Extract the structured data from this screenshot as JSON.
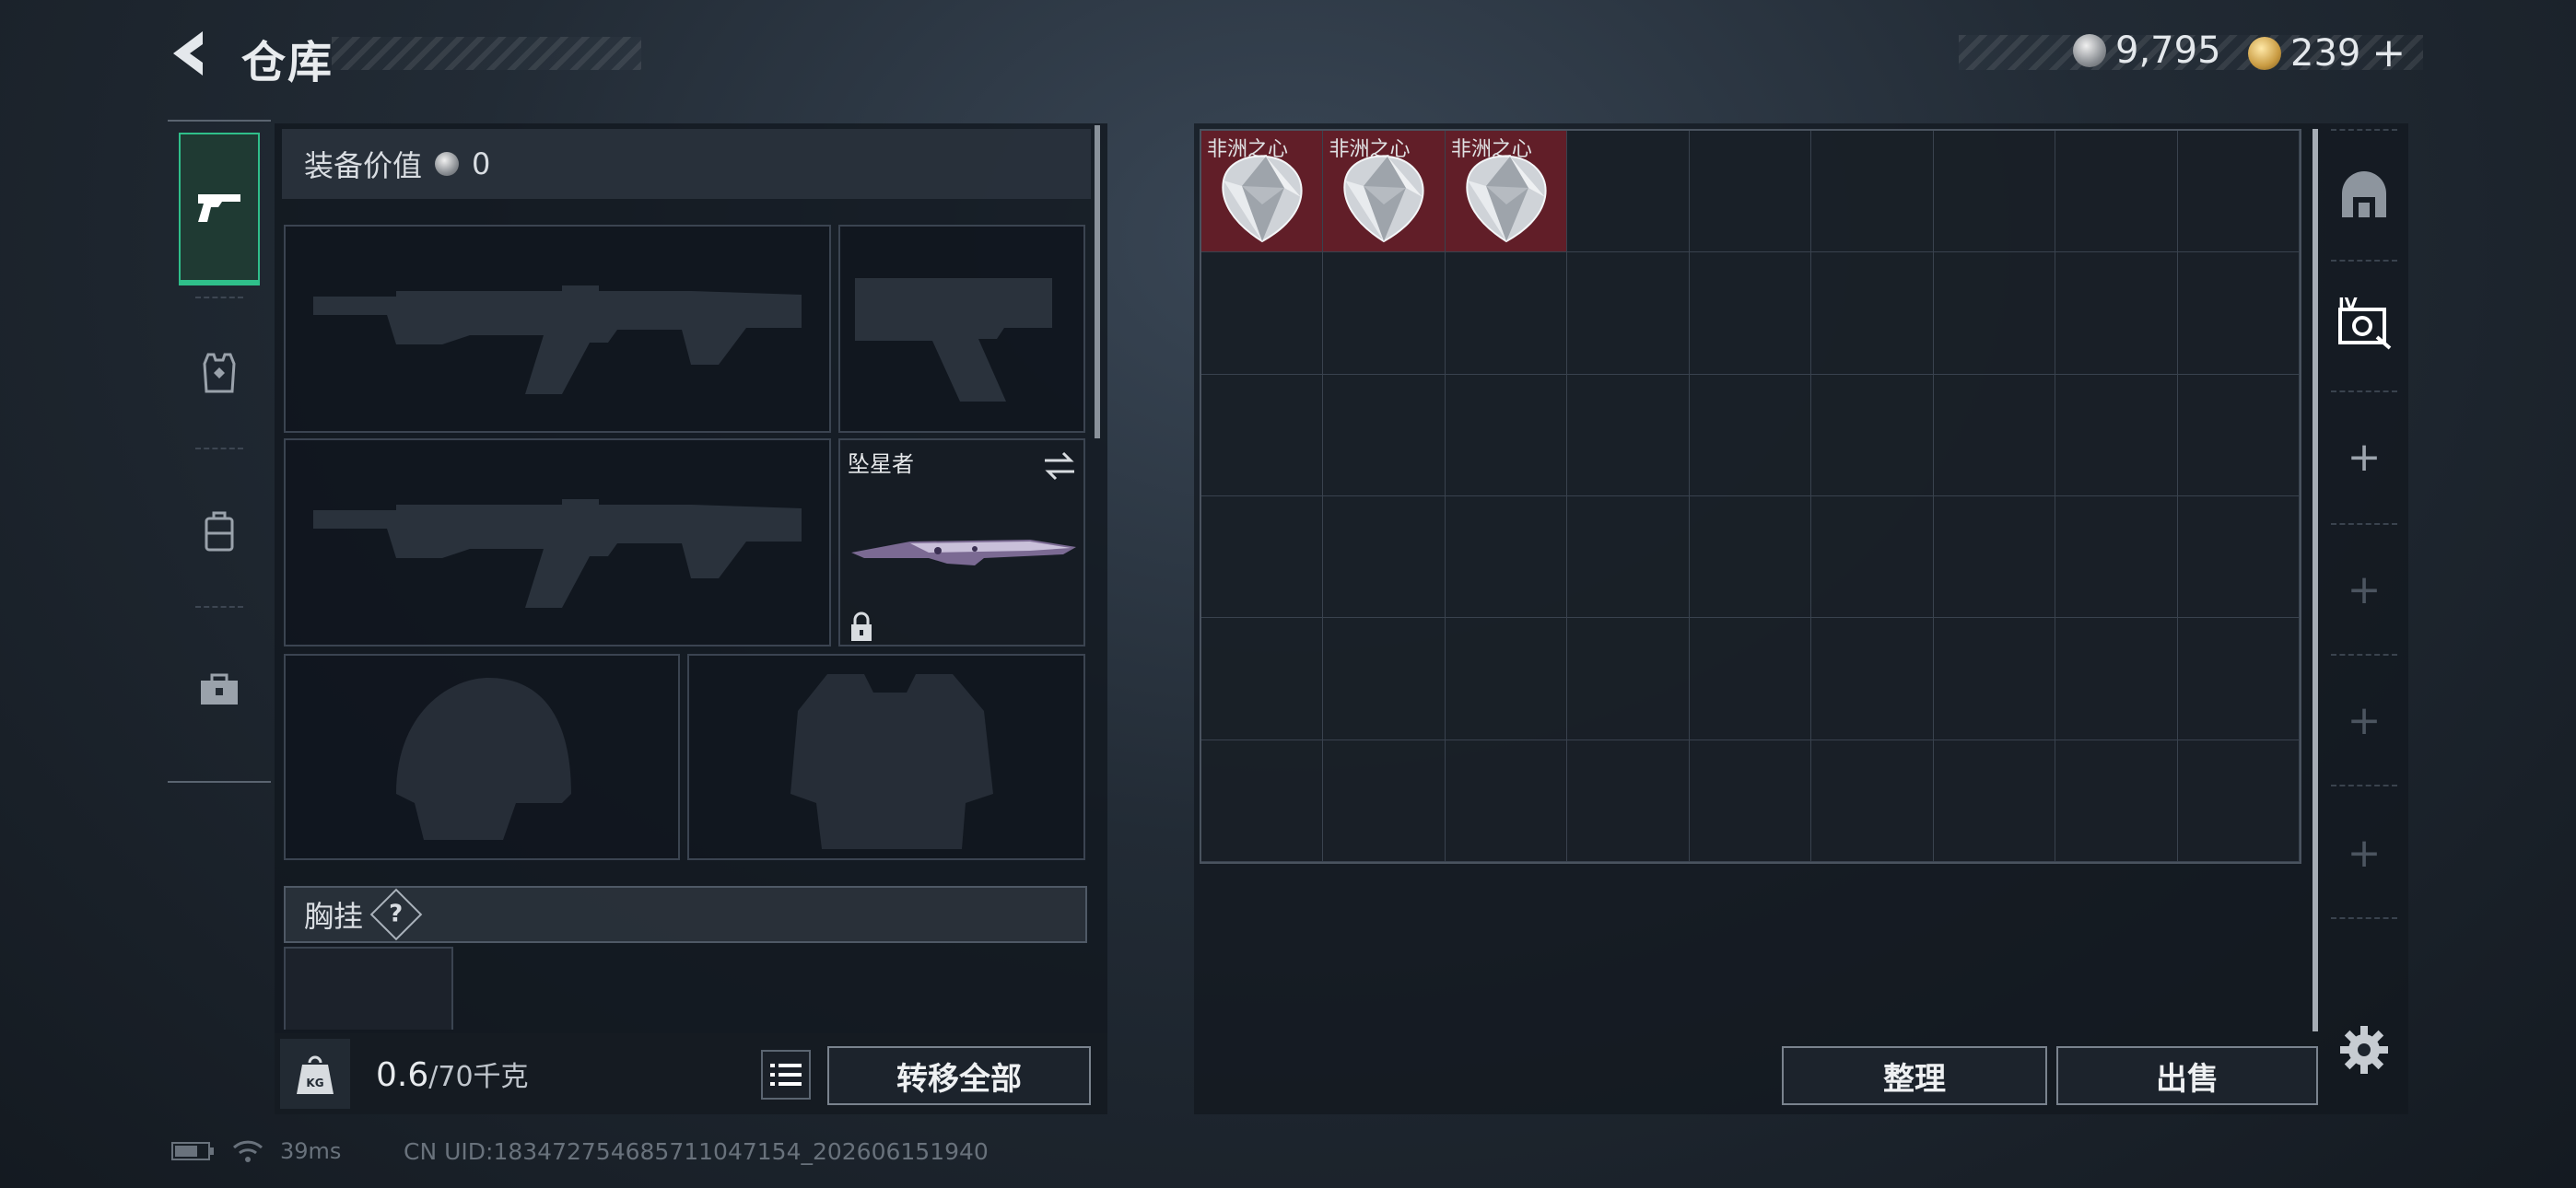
{
  "header": {
    "title": "仓库",
    "silver_amount": "9,795",
    "gold_amount": "239",
    "add_symbol": "+"
  },
  "nav": {
    "items": [
      {
        "name": "weapons",
        "icon": "pistol-icon",
        "active": true
      },
      {
        "name": "armor",
        "icon": "vest-icon",
        "active": false
      },
      {
        "name": "backpack",
        "icon": "backpack-icon",
        "active": false
      },
      {
        "name": "toolbox",
        "icon": "toolbox-icon",
        "active": false
      }
    ]
  },
  "equipment": {
    "value_label": "装备价值",
    "value": "0",
    "melee_name": "坠星者",
    "chest_rig_label": "胸挂",
    "chest_rig_help": "?"
  },
  "weight": {
    "current": "0.6",
    "max": "/70千克",
    "icon_label": "KG"
  },
  "buttons": {
    "transfer_all": "转移全部",
    "organize": "整理",
    "sell": "出售"
  },
  "storage": {
    "columns": 9,
    "rows": 6,
    "items": [
      {
        "name": "非洲之心",
        "col": 0,
        "row": 0
      },
      {
        "name": "非洲之心",
        "col": 1,
        "row": 0
      },
      {
        "name": "非洲之心",
        "col": 2,
        "row": 0
      }
    ]
  },
  "right_tabs": {
    "items": [
      "warehouse-icon",
      "storage-box-icon",
      "add-icon",
      "add-icon",
      "add-icon",
      "add-icon"
    ],
    "add_symbol": "+"
  },
  "status": {
    "ping": "39ms",
    "uid": "CN UID:183472754685711047154_202606151940"
  },
  "colors": {
    "accent_green": "#2fbf8a",
    "item_highlight": "#7a1e28"
  }
}
